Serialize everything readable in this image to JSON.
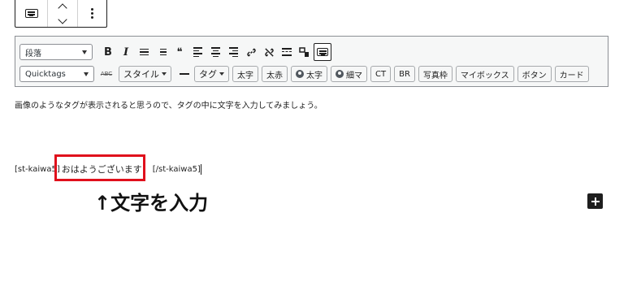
{
  "block_toolbar": {
    "icons": [
      "keyboard-icon",
      "chevron-up-icon",
      "chevron-down-icon",
      "more-vertical-icon"
    ]
  },
  "editor_toolbar": {
    "format_select": "段落",
    "quicktags_select": "Quicktags",
    "format_icons": [
      "bold-icon",
      "italic-icon",
      "bullet-list-icon",
      "numbered-list-icon",
      "blockquote-icon",
      "align-left-icon",
      "align-center-icon",
      "align-right-icon",
      "link-icon",
      "unlink-icon",
      "read-more-icon",
      "toolbar-toggle-icon",
      "keyboard-icon"
    ],
    "bold_glyph": "B",
    "italic_glyph": "I",
    "quote_glyph": "❝",
    "strike_glyph": "ABC",
    "style_button": "スタイル",
    "tag_button": "タグ",
    "buttons": [
      "太字",
      "太赤"
    ],
    "user_bold": "太字",
    "user_thin": "細マ",
    "buttons2": [
      "CT",
      "BR",
      "写真枠",
      "マイボックス",
      "ボタン",
      "カード"
    ]
  },
  "content": {
    "paragraph": "画像のようなタグが表示されると思うので、タグの中に文字を入力してみましょう。",
    "shortcode_open": "[st-kaiwa5]",
    "shortcode_text": "おはようございます！",
    "shortcode_close": "[/st-kaiwa5]",
    "annotation": "↑文字を入力"
  },
  "colors": {
    "highlight": "#e0101c"
  }
}
